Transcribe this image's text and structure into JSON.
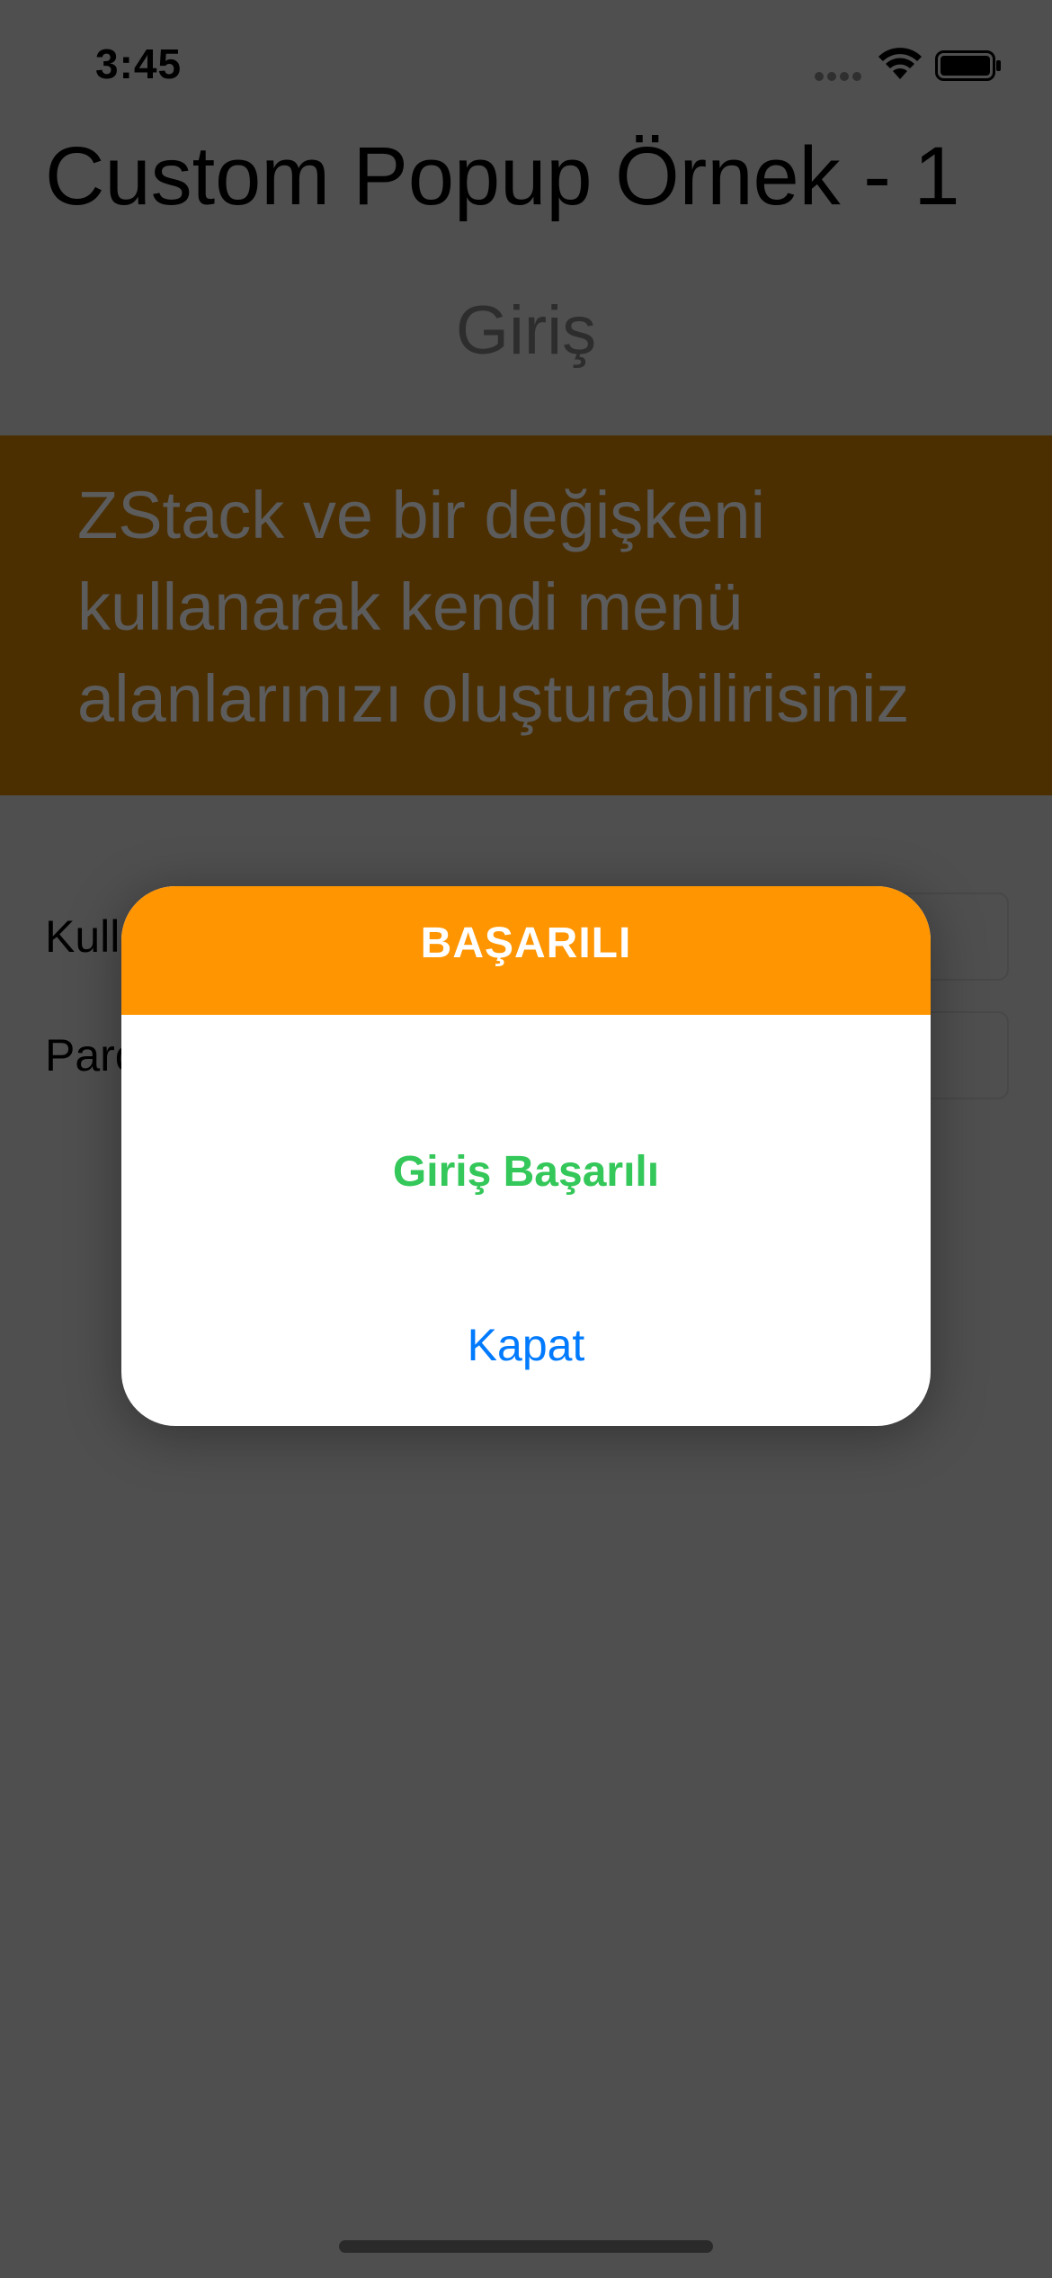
{
  "status_bar": {
    "time": "3:45",
    "icons": [
      "signal-icon",
      "wifi-icon",
      "battery-icon"
    ]
  },
  "page": {
    "title": "Custom Popup Örnek - 1",
    "heading": "Giriş",
    "info_text": "ZStack ve bir değişkeni kullanarak kendi menü alanlarınızı oluşturabilirisiniz"
  },
  "form": {
    "username_label_visible": "Kull",
    "password_label_visible": "Parc"
  },
  "popup": {
    "title": "BAŞARILI",
    "message": "Giriş Başarılı",
    "close_label": "Kapat"
  },
  "colors": {
    "popup_header": "#ff9500",
    "banner_background": "#4c2f00",
    "message_text": "#34c759",
    "close_button_text": "#007aff",
    "dim_background": "#4f4f4f"
  }
}
